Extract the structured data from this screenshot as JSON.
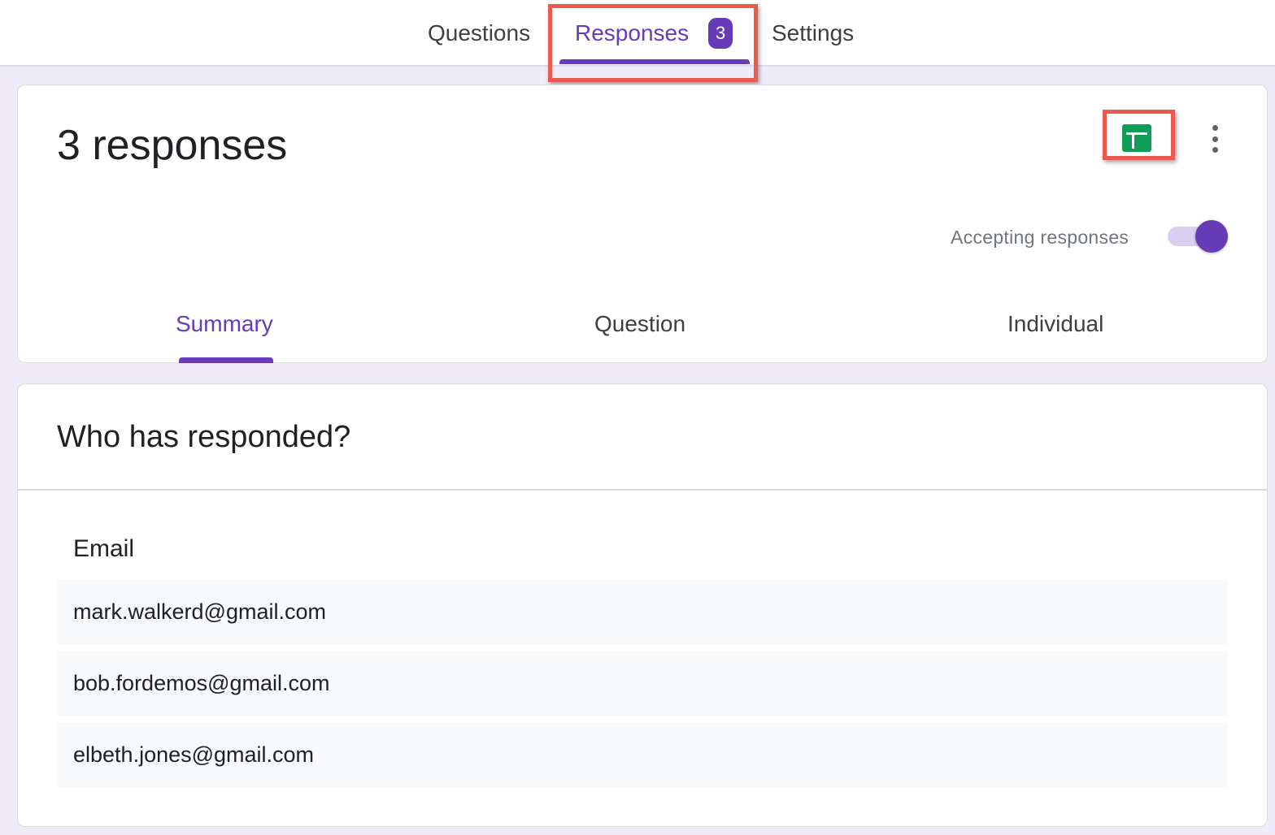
{
  "top_tabs": {
    "questions": "Questions",
    "responses": "Responses",
    "responses_count": "3",
    "settings": "Settings"
  },
  "header": {
    "title": "3 responses",
    "sheets_icon": "sheets-icon",
    "more_icon": "more-vert-icon",
    "accepting_label": "Accepting responses",
    "accepting_enabled": true
  },
  "sub_tabs": {
    "summary": "Summary",
    "question": "Question",
    "individual": "Individual"
  },
  "respondents": {
    "title": "Who has responded?",
    "column_header": "Email",
    "emails": [
      "mark.walkerd@gmail.com",
      "bob.fordemos@gmail.com",
      "elbeth.jones@gmail.com"
    ]
  },
  "colors": {
    "accent": "#673ab7",
    "sheets_green": "#0f9d58",
    "highlight": "#ea5a4f",
    "page_background": "#f0ebf8"
  }
}
